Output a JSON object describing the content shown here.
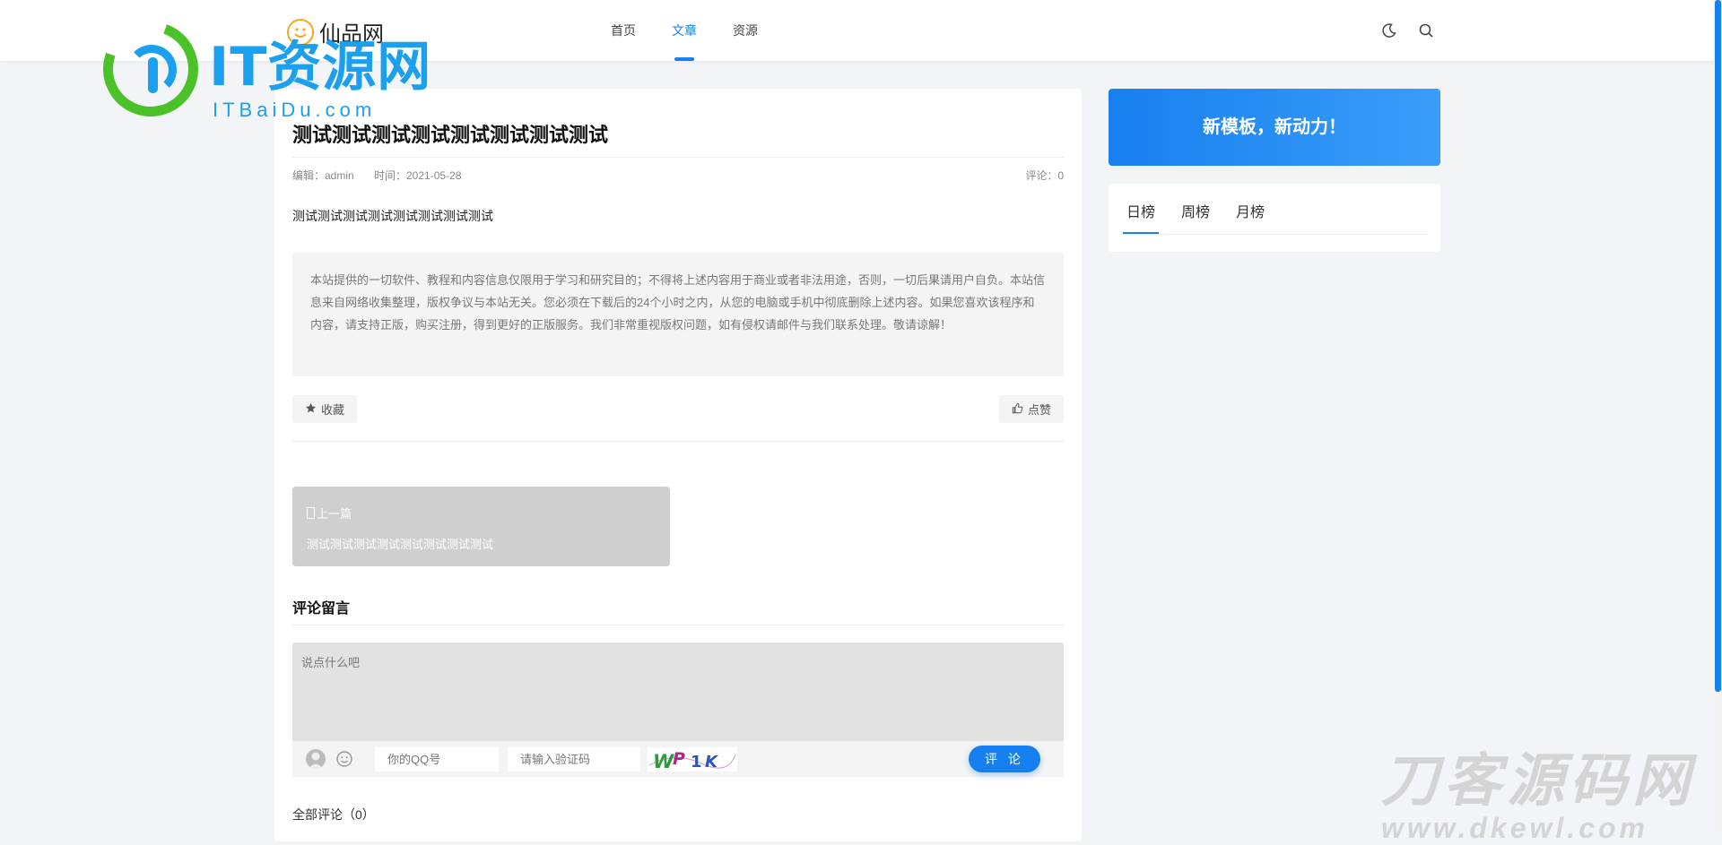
{
  "header": {
    "logo_text": "仙品网",
    "nav": [
      {
        "label": "首页",
        "active": false
      },
      {
        "label": "文章",
        "active": true
      },
      {
        "label": "资源",
        "active": false
      }
    ],
    "icons": [
      "moon-icon",
      "search-icon"
    ]
  },
  "watermarks": {
    "top_title": "IT资源网",
    "top_sub": "ITBaiDu.com",
    "bottom_title": "刀客源码网",
    "bottom_sub": "www.dkewl.com"
  },
  "article": {
    "title": "测试测试测试测试测试测试测试测试",
    "editor": "编辑：admin",
    "time": "时间：2021-05-28",
    "comments": "评论：0",
    "lead": "测试测试测试测试测试测试测试测试",
    "notice": "本站提供的一切软件、教程和内容信息仅限用于学习和研究目的；不得将上述内容用于商业或者非法用途，否则，一切后果请用户自负。本站信息来自网络收集整理，版权争议与本站无关。您必须在下载后的24个小时之内，从您的电脑或手机中彻底删除上述内容。如果您喜欢该程序和内容，请支持正版，购买注册，得到更好的正版服务。我们非常重视版权问题，如有侵权请邮件与我们联系处理。敬请谅解！",
    "favorite_label": "收藏",
    "like_label": "点赞",
    "prev_label": "上一篇",
    "prev_title": "测试测试测试测试测试测试测试测试"
  },
  "comments": {
    "section_title": "评论留言",
    "textarea_placeholder": "说点什么吧",
    "qq_placeholder": "你的QQ号",
    "captcha_placeholder": "请输入验证码",
    "captcha_text": "WP1K",
    "submit_label": "评 论",
    "all_label": "全部评论（0）"
  },
  "sidebar": {
    "promo_text": "新模板，新动力！",
    "rank_tabs": [
      {
        "label": "日榜",
        "active": true
      },
      {
        "label": "周榜",
        "active": false
      },
      {
        "label": "月榜",
        "active": false
      }
    ]
  },
  "colors": {
    "accent": "#1780f0",
    "background": "#f2f4f7"
  }
}
